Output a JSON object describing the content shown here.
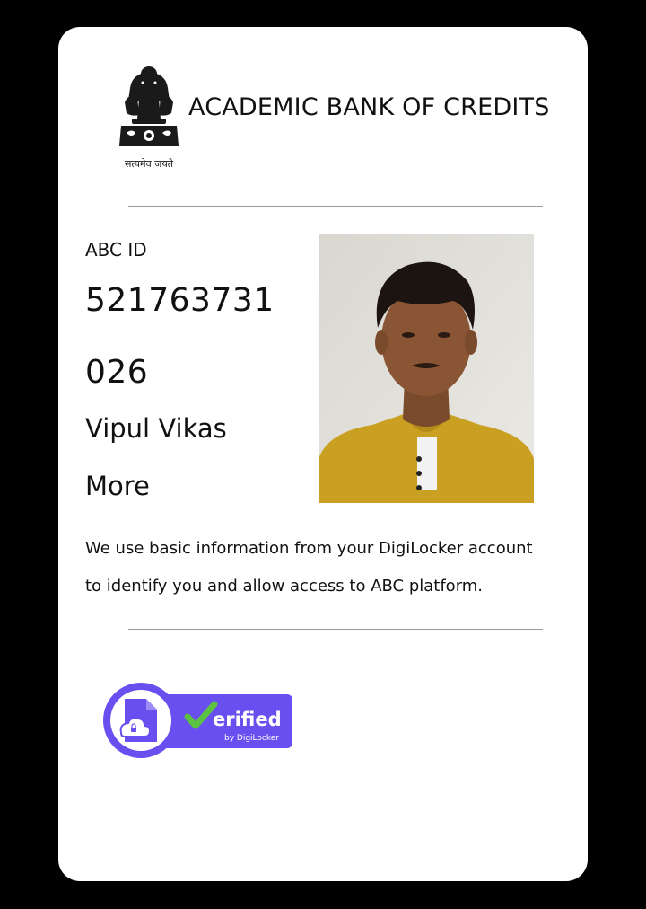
{
  "header": {
    "title": "ACADEMIC BANK OF CREDITS",
    "emblem_motto": "सत्यमेव जयते"
  },
  "profile": {
    "id_label": "ABC ID",
    "id_line_1": "521763731",
    "id_line_2": "026",
    "name_line_1": "Vipul Vikas",
    "name_line_2": "More"
  },
  "info": {
    "line_1": "We use basic information from your DigiLocker account",
    "line_2": "to identify you and allow access to ABC platform."
  },
  "badge": {
    "verified_text": "erified",
    "by_text": "by DigiLocker"
  },
  "colors": {
    "card_background": "#ffffff",
    "page_background": "#000000",
    "badge_purple": "#6a4ff0",
    "check_green": "#5cc241",
    "shirt_yellow": "#c9a022"
  },
  "icons": [
    "national-emblem-icon",
    "profile-photo",
    "digilocker-cloud-document-icon",
    "checkmark-icon"
  ]
}
